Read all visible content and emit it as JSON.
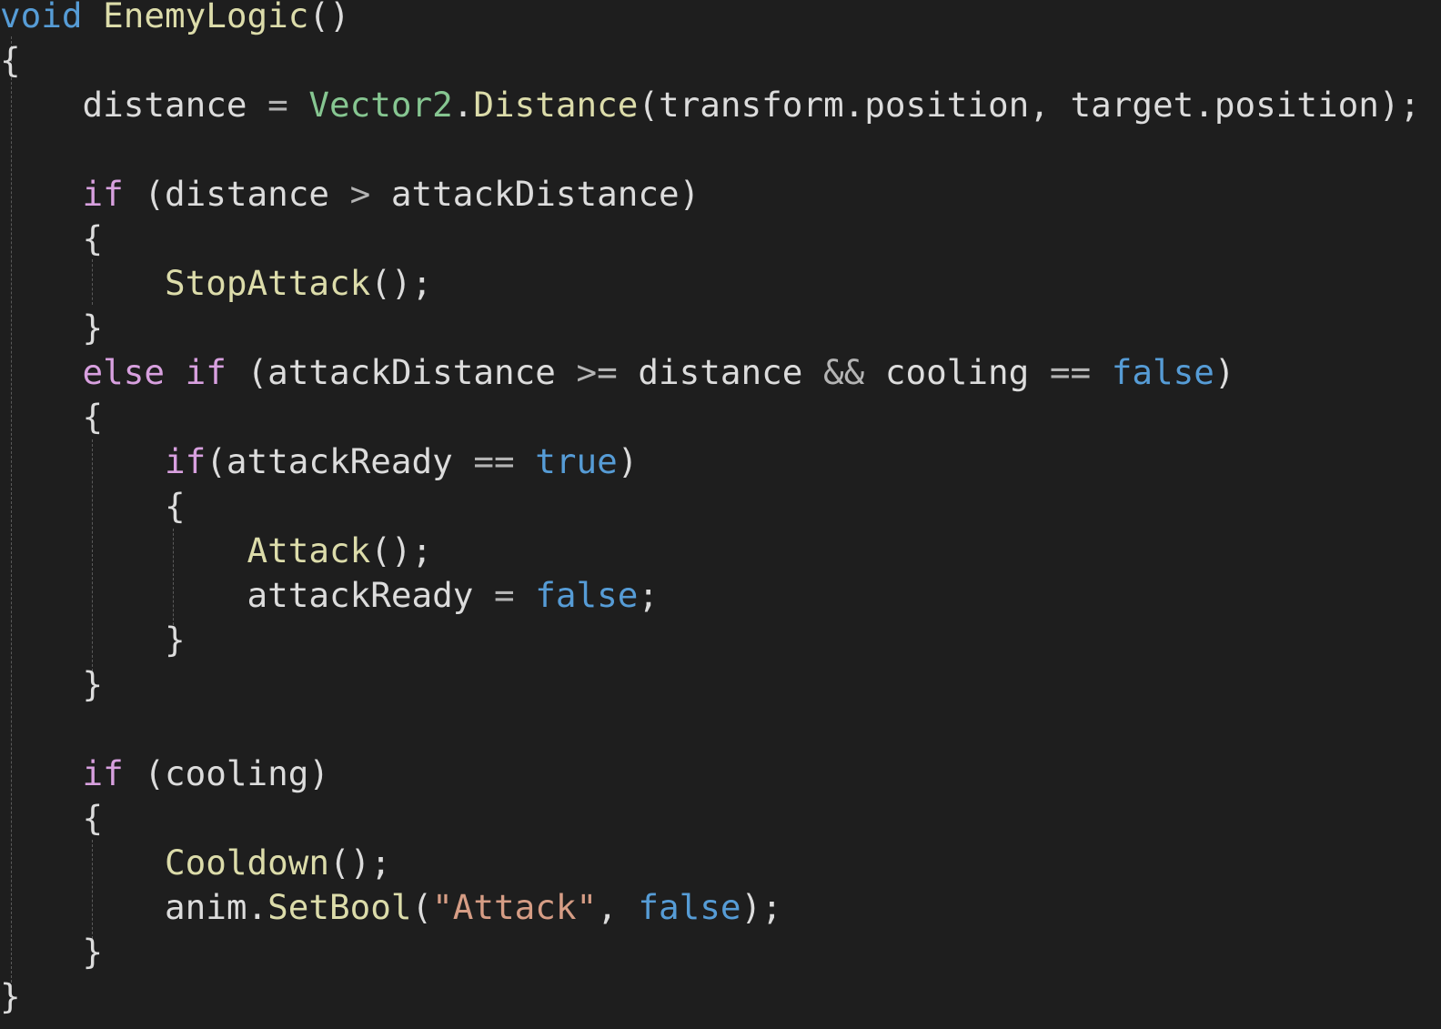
{
  "editor": {
    "theme": {
      "background": "#1e1e1e",
      "keyword": "#569cd6",
      "control": "#d8a0df",
      "method": "#dcdcaa",
      "type": "#86c691",
      "string": "#d69d85",
      "operator": "#b4b4b4",
      "plain": "#dcdcdc",
      "indent_guide": "#5a5a5a"
    },
    "lines": [
      [
        {
          "t": "void",
          "k": "keyword"
        },
        {
          "t": " ",
          "k": "plain"
        },
        {
          "t": "EnemyLogic",
          "k": "method"
        },
        {
          "t": "()",
          "k": "plain"
        }
      ],
      [
        {
          "t": "{",
          "k": "plain"
        }
      ],
      [
        {
          "t": "    distance ",
          "k": "plain"
        },
        {
          "t": "=",
          "k": "operator"
        },
        {
          "t": " ",
          "k": "plain"
        },
        {
          "t": "Vector2",
          "k": "type"
        },
        {
          "t": ".",
          "k": "plain"
        },
        {
          "t": "Distance",
          "k": "method"
        },
        {
          "t": "(transform.position, target.position);",
          "k": "plain"
        }
      ],
      [],
      [
        {
          "t": "    ",
          "k": "plain"
        },
        {
          "t": "if",
          "k": "control"
        },
        {
          "t": " (distance ",
          "k": "plain"
        },
        {
          "t": ">",
          "k": "operator"
        },
        {
          "t": " attackDistance)",
          "k": "plain"
        }
      ],
      [
        {
          "t": "    {",
          "k": "plain"
        }
      ],
      [
        {
          "t": "        ",
          "k": "plain"
        },
        {
          "t": "StopAttack",
          "k": "method"
        },
        {
          "t": "();",
          "k": "plain"
        }
      ],
      [
        {
          "t": "    }",
          "k": "plain"
        }
      ],
      [
        {
          "t": "    ",
          "k": "plain"
        },
        {
          "t": "else",
          "k": "control"
        },
        {
          "t": " ",
          "k": "plain"
        },
        {
          "t": "if",
          "k": "control"
        },
        {
          "t": " (attackDistance ",
          "k": "plain"
        },
        {
          "t": ">=",
          "k": "operator"
        },
        {
          "t": " distance ",
          "k": "plain"
        },
        {
          "t": "&&",
          "k": "operator"
        },
        {
          "t": " cooling ",
          "k": "plain"
        },
        {
          "t": "==",
          "k": "operator"
        },
        {
          "t": " ",
          "k": "plain"
        },
        {
          "t": "false",
          "k": "keyword"
        },
        {
          "t": ")",
          "k": "plain"
        }
      ],
      [
        {
          "t": "    {",
          "k": "plain"
        }
      ],
      [
        {
          "t": "        ",
          "k": "plain"
        },
        {
          "t": "if",
          "k": "control"
        },
        {
          "t": "(attackReady ",
          "k": "plain"
        },
        {
          "t": "==",
          "k": "operator"
        },
        {
          "t": " ",
          "k": "plain"
        },
        {
          "t": "true",
          "k": "keyword"
        },
        {
          "t": ")",
          "k": "plain"
        }
      ],
      [
        {
          "t": "        {",
          "k": "plain"
        }
      ],
      [
        {
          "t": "            ",
          "k": "plain"
        },
        {
          "t": "Attack",
          "k": "method"
        },
        {
          "t": "();",
          "k": "plain"
        }
      ],
      [
        {
          "t": "            attackReady ",
          "k": "plain"
        },
        {
          "t": "=",
          "k": "operator"
        },
        {
          "t": " ",
          "k": "plain"
        },
        {
          "t": "false",
          "k": "keyword"
        },
        {
          "t": ";",
          "k": "plain"
        }
      ],
      [
        {
          "t": "        }",
          "k": "plain"
        }
      ],
      [
        {
          "t": "    }",
          "k": "plain"
        }
      ],
      [],
      [
        {
          "t": "    ",
          "k": "plain"
        },
        {
          "t": "if",
          "k": "control"
        },
        {
          "t": " (cooling)",
          "k": "plain"
        }
      ],
      [
        {
          "t": "    {",
          "k": "plain"
        }
      ],
      [
        {
          "t": "        ",
          "k": "plain"
        },
        {
          "t": "Cooldown",
          "k": "method"
        },
        {
          "t": "();",
          "k": "plain"
        }
      ],
      [
        {
          "t": "        anim.",
          "k": "plain"
        },
        {
          "t": "SetBool",
          "k": "method"
        },
        {
          "t": "(",
          "k": "plain"
        },
        {
          "t": "\"Attack\"",
          "k": "string"
        },
        {
          "t": ", ",
          "k": "plain"
        },
        {
          "t": "false",
          "k": "keyword"
        },
        {
          "t": ");",
          "k": "plain"
        }
      ],
      [
        {
          "t": "    }",
          "k": "plain"
        }
      ],
      [
        {
          "t": "}",
          "k": "plain"
        }
      ]
    ]
  }
}
